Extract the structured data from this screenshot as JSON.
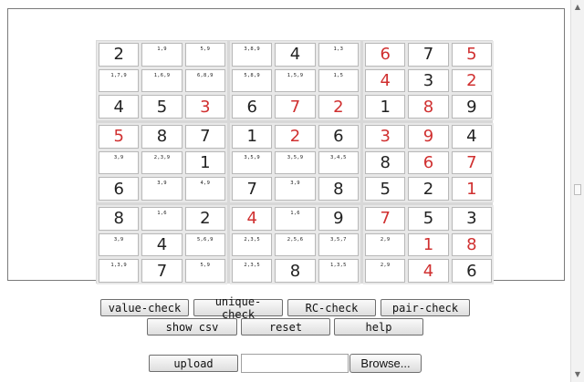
{
  "colors": {
    "given": "#222222",
    "entered": "#d03030"
  },
  "board": [
    [
      {
        "v": "2",
        "c": "given"
      },
      {
        "v": "1,9",
        "c": "cand"
      },
      {
        "v": "5,9",
        "c": "cand"
      },
      {
        "v": "3,8,9",
        "c": "cand"
      },
      {
        "v": "4",
        "c": "given"
      },
      {
        "v": "1,3",
        "c": "cand"
      },
      {
        "v": "6",
        "c": "red"
      },
      {
        "v": "7",
        "c": "given"
      },
      {
        "v": "5",
        "c": "red"
      }
    ],
    [
      {
        "v": "1,7,9",
        "c": "cand"
      },
      {
        "v": "1,6,9",
        "c": "cand"
      },
      {
        "v": "6,8,9",
        "c": "cand"
      },
      {
        "v": "5,8,9",
        "c": "cand"
      },
      {
        "v": "1,5,9",
        "c": "cand"
      },
      {
        "v": "1,5",
        "c": "cand"
      },
      {
        "v": "4",
        "c": "red"
      },
      {
        "v": "3",
        "c": "given"
      },
      {
        "v": "2",
        "c": "red"
      }
    ],
    [
      {
        "v": "4",
        "c": "given"
      },
      {
        "v": "5",
        "c": "given"
      },
      {
        "v": "3",
        "c": "red"
      },
      {
        "v": "6",
        "c": "given"
      },
      {
        "v": "7",
        "c": "red"
      },
      {
        "v": "2",
        "c": "red"
      },
      {
        "v": "1",
        "c": "given"
      },
      {
        "v": "8",
        "c": "red"
      },
      {
        "v": "9",
        "c": "given"
      }
    ],
    [
      {
        "v": "5",
        "c": "red"
      },
      {
        "v": "8",
        "c": "given"
      },
      {
        "v": "7",
        "c": "given"
      },
      {
        "v": "1",
        "c": "given"
      },
      {
        "v": "2",
        "c": "red"
      },
      {
        "v": "6",
        "c": "given"
      },
      {
        "v": "3",
        "c": "red"
      },
      {
        "v": "9",
        "c": "red"
      },
      {
        "v": "4",
        "c": "given"
      }
    ],
    [
      {
        "v": "3,9",
        "c": "cand"
      },
      {
        "v": "2,3,9",
        "c": "cand"
      },
      {
        "v": "1",
        "c": "given"
      },
      {
        "v": "3,5,9",
        "c": "cand"
      },
      {
        "v": "3,5,9",
        "c": "cand"
      },
      {
        "v": "3,4,5",
        "c": "cand"
      },
      {
        "v": "8",
        "c": "given"
      },
      {
        "v": "6",
        "c": "red"
      },
      {
        "v": "7",
        "c": "red"
      }
    ],
    [
      {
        "v": "6",
        "c": "given"
      },
      {
        "v": "3,9",
        "c": "cand"
      },
      {
        "v": "4,9",
        "c": "cand"
      },
      {
        "v": "7",
        "c": "given"
      },
      {
        "v": "3,9",
        "c": "cand"
      },
      {
        "v": "8",
        "c": "given"
      },
      {
        "v": "5",
        "c": "given"
      },
      {
        "v": "2",
        "c": "given"
      },
      {
        "v": "1",
        "c": "red"
      }
    ],
    [
      {
        "v": "8",
        "c": "given"
      },
      {
        "v": "1,6",
        "c": "cand"
      },
      {
        "v": "2",
        "c": "given"
      },
      {
        "v": "4",
        "c": "red"
      },
      {
        "v": "1,6",
        "c": "cand"
      },
      {
        "v": "9",
        "c": "given"
      },
      {
        "v": "7",
        "c": "red"
      },
      {
        "v": "5",
        "c": "given"
      },
      {
        "v": "3",
        "c": "given"
      }
    ],
    [
      {
        "v": "3,9",
        "c": "cand"
      },
      {
        "v": "4",
        "c": "given"
      },
      {
        "v": "5,6,9",
        "c": "cand"
      },
      {
        "v": "2,3,5",
        "c": "cand"
      },
      {
        "v": "2,5,6",
        "c": "cand"
      },
      {
        "v": "3,5,7",
        "c": "cand"
      },
      {
        "v": "2,9",
        "c": "cand"
      },
      {
        "v": "1",
        "c": "red"
      },
      {
        "v": "8",
        "c": "red"
      }
    ],
    [
      {
        "v": "1,3,9",
        "c": "cand"
      },
      {
        "v": "7",
        "c": "given"
      },
      {
        "v": "5,9",
        "c": "cand"
      },
      {
        "v": "2,3,5",
        "c": "cand"
      },
      {
        "v": "8",
        "c": "given"
      },
      {
        "v": "1,3,5",
        "c": "cand"
      },
      {
        "v": "2,9",
        "c": "cand"
      },
      {
        "v": "4",
        "c": "red"
      },
      {
        "v": "6",
        "c": "given"
      }
    ]
  ],
  "controls": {
    "value_check": "value-check",
    "unique_check": "unique-check",
    "rc_check": "RC-check",
    "pair_check": "pair-check",
    "show_csv": "show csv",
    "reset": "reset",
    "help": "help",
    "upload": "upload",
    "file_value": "",
    "browse": "Browse..."
  },
  "scrollbar": {
    "up_icon": "arrow-up-icon",
    "down_icon": "arrow-down-icon"
  }
}
